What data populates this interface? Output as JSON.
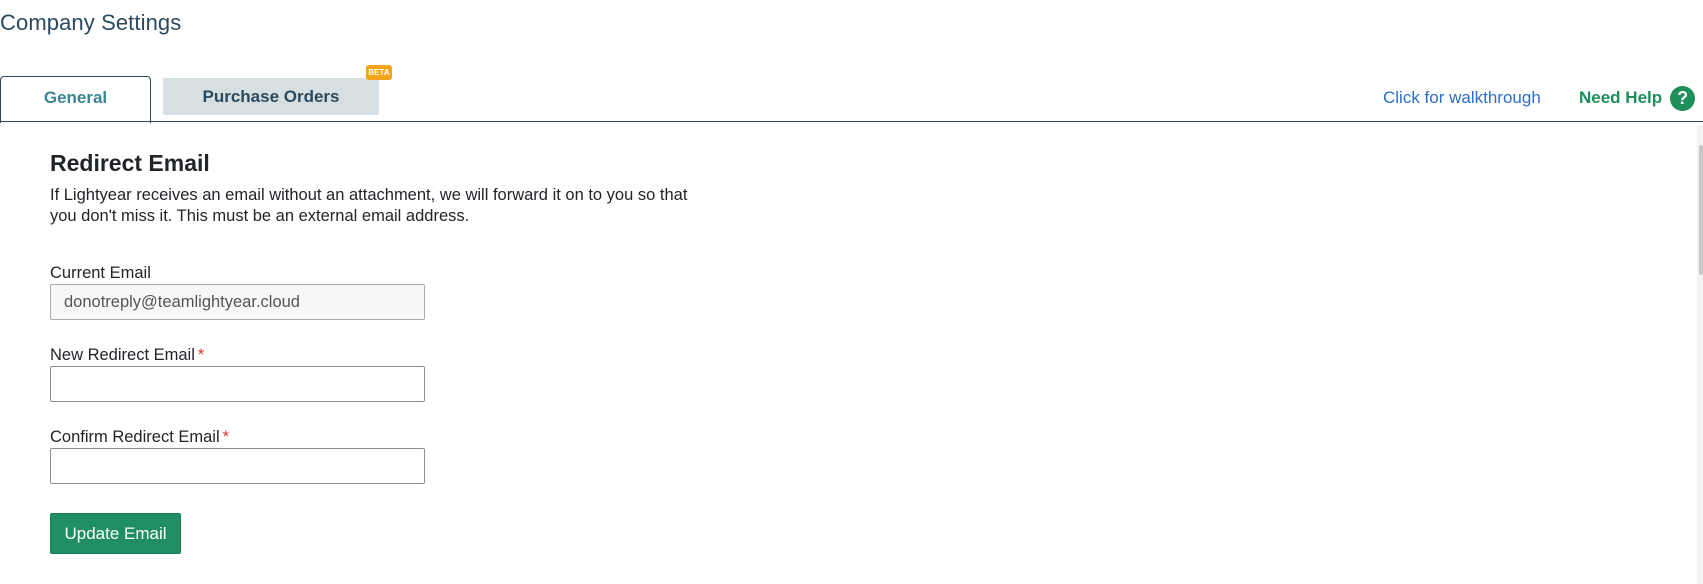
{
  "page": {
    "title": "Company Settings"
  },
  "tabs": [
    {
      "label": "General",
      "active": true
    },
    {
      "label": "Purchase Orders",
      "active": false,
      "badge": "BETA"
    }
  ],
  "header_links": {
    "walkthrough": "Click for walkthrough",
    "help": "Need Help",
    "help_icon": "?"
  },
  "section": {
    "title": "Redirect Email",
    "description": "If Lightyear receives an email without an attachment, we will forward it on to you so that you don't miss it. This must be an external email address."
  },
  "fields": {
    "current_email": {
      "label": "Current Email",
      "value": "donotreply@teamlightyear.cloud"
    },
    "new_email": {
      "label": "New Redirect Email",
      "required_marker": "*",
      "value": ""
    },
    "confirm_email": {
      "label": "Confirm Redirect Email",
      "required_marker": "*",
      "value": ""
    }
  },
  "actions": {
    "update": "Update Email"
  },
  "colors": {
    "title": "#2c4a5e",
    "tab_active_text": "#3a8593",
    "tab_inactive_bg": "#d6dfe2",
    "beta_badge": "#f5a31a",
    "link": "#2a6fc9",
    "help": "#1e8e5a",
    "primary_button": "#1f8f63",
    "required": "#d9342b"
  }
}
